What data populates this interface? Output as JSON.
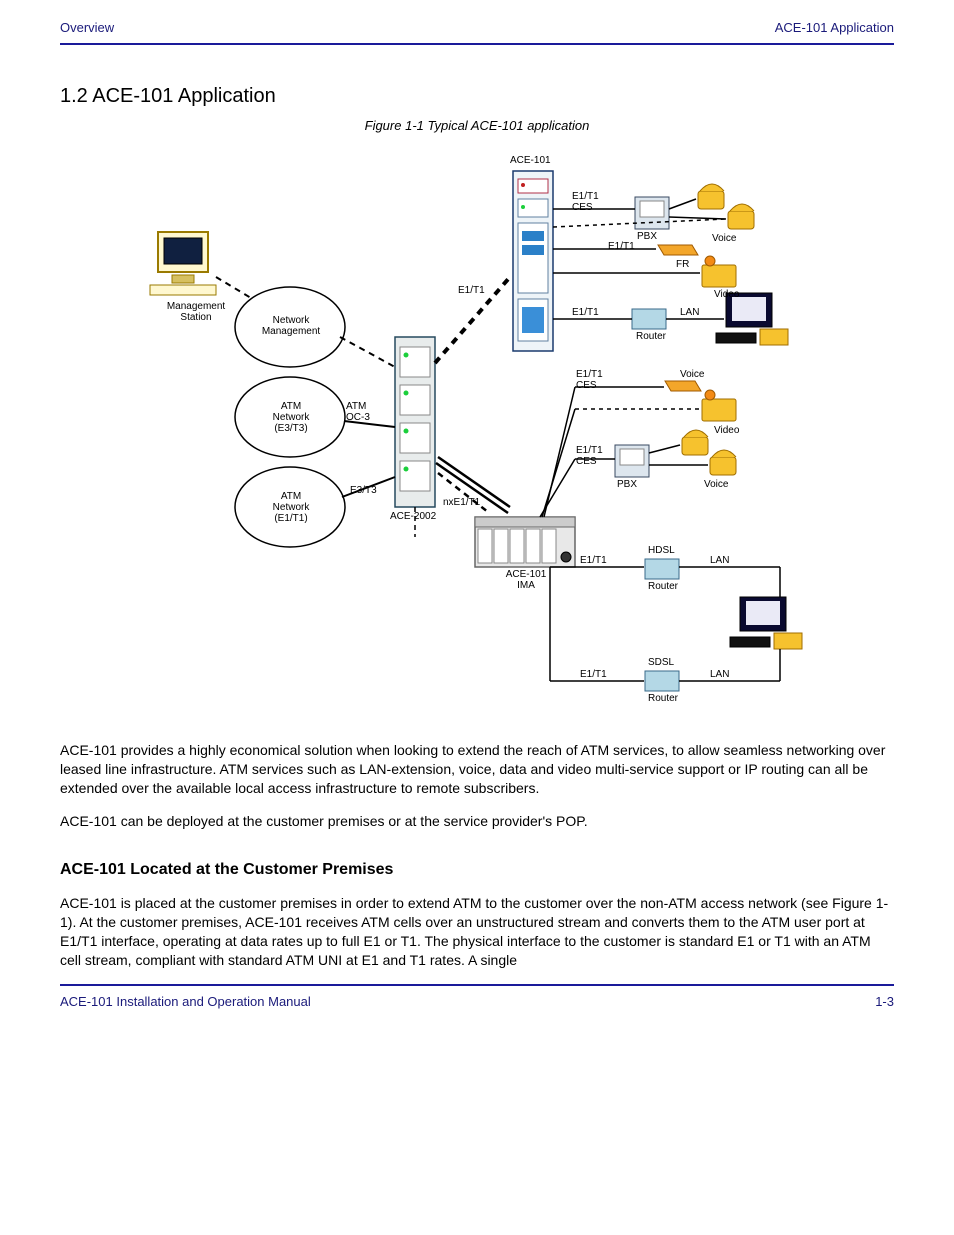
{
  "header": {
    "left": "Overview",
    "right": "ACE-101 Application"
  },
  "section_title": "1.2 ACE-101 Application",
  "figure_caption": "Figure 1-1  Typical ACE-101 application",
  "diagram": {
    "mgmt_station": "Management\nStation",
    "network": "Network\nManagement",
    "cloud_atm_e3": "ATM\nNetwork\n(E3/T3)",
    "cloud_atm_e1": "ATM\nNetwork\n(E1/T1)",
    "ace2002": "ACE-2002",
    "ace101_1": "ACE-101",
    "ace101_2": "ACE-101\nIMA",
    "e1t1": "E1/T1",
    "e1t1_ces": "E1/T1\nCES",
    "atmoc3": "ATM\nOC-3",
    "e3t3": "E3/T3",
    "nxE1T1": "nxE1/T1",
    "pbx": "PBX",
    "lan": "LAN",
    "voice": "Voice",
    "fr": "FR",
    "hdsl": "HDSL",
    "sdsl": "SDSL",
    "pbx2": "PBX",
    "router": "Router",
    "router2": "Router",
    "video": "Video"
  },
  "para1": "ACE-101 provides a highly economical solution when looking to extend the reach of ATM services, to allow seamless networking over leased line infrastructure. ATM services such as LAN-extension, voice, data and video multi-service support or IP routing can all be extended over the available local access infrastructure to remote subscribers.",
  "para2": "ACE-101 can be deployed at the customer premises or at the service provider's POP.",
  "h_cpe": "ACE-101 Located at the Customer Premises",
  "para3": "ACE-101 is placed at the customer premises in order to extend ATM to the customer over the non-ATM access network (see Figure 1-1). At the customer premises, ACE-101 receives ATM cells over an unstructured stream and converts them to the ATM user port at E1/T1 interface, operating at data rates up to full E1 or T1. The physical interface to the customer is standard E1 or T1 with an ATM cell stream, compliant with standard ATM UNI at E1 and T1 rates. A single",
  "footer": {
    "left": "ACE-101 Installation and Operation Manual",
    "right": "1-3"
  },
  "chart_data": {
    "type": "diagram",
    "nodes": [
      {
        "id": "mgmt",
        "label": "Management Station"
      },
      {
        "id": "cloud_nm",
        "label": "Network Management"
      },
      {
        "id": "cloud_e3",
        "label": "ATM Network (E3/T3)"
      },
      {
        "id": "cloud_e1",
        "label": "ATM Network (E1/T1)"
      },
      {
        "id": "ace2002",
        "label": "ACE-2002"
      },
      {
        "id": "ace101_1",
        "label": "ACE-101"
      },
      {
        "id": "ace101_2",
        "label": "ACE-101 IMA"
      },
      {
        "id": "pbx1",
        "label": "PBX"
      },
      {
        "id": "voice1",
        "label": "Voice"
      },
      {
        "id": "fr",
        "label": "FR"
      },
      {
        "id": "video1",
        "label": "Video"
      },
      {
        "id": "router1",
        "label": "Router"
      },
      {
        "id": "lan1",
        "label": "LAN"
      },
      {
        "id": "computer1",
        "label": "Computer"
      },
      {
        "id": "voice2",
        "label": "Voice"
      },
      {
        "id": "video2",
        "label": "Video"
      },
      {
        "id": "pbx2",
        "label": "PBX"
      },
      {
        "id": "hdsl",
        "label": "HDSL Router"
      },
      {
        "id": "sdsl",
        "label": "SDSL Router"
      },
      {
        "id": "computer2",
        "label": "Computer"
      }
    ],
    "edges": [
      {
        "from": "mgmt",
        "to": "cloud_nm",
        "style": "dashed"
      },
      {
        "from": "cloud_nm",
        "to": "ace2002",
        "style": "dashed"
      },
      {
        "from": "cloud_e3",
        "to": "ace2002",
        "label": "ATM OC-3"
      },
      {
        "from": "cloud_e1",
        "to": "ace2002",
        "label": "E3/T3"
      },
      {
        "from": "ace2002",
        "to": "ace101_1",
        "label": "E1/T1",
        "style": "dashed"
      },
      {
        "from": "ace2002",
        "to": "ace101_2",
        "label": "nxE1/T1"
      },
      {
        "from": "ace101_1",
        "to": "pbx1",
        "label": "E1/T1 CES"
      },
      {
        "from": "pbx1",
        "to": "voice1"
      },
      {
        "from": "ace101_1",
        "to": "voice1",
        "style": "dashed"
      },
      {
        "from": "ace101_1",
        "to": "fr"
      },
      {
        "from": "ace101_1",
        "to": "video1"
      },
      {
        "from": "ace101_1",
        "to": "router1",
        "label": "LAN"
      },
      {
        "from": "router1",
        "to": "computer1"
      },
      {
        "from": "ace101_2",
        "to": "voice2",
        "label": "E1/T1 CES"
      },
      {
        "from": "ace101_2",
        "to": "video2",
        "style": "dashed"
      },
      {
        "from": "ace101_2",
        "to": "pbx2",
        "label": "E1/T1 CES"
      },
      {
        "from": "pbx2",
        "to": "voice2"
      },
      {
        "from": "ace101_2",
        "to": "hdsl",
        "label": "E1/T1"
      },
      {
        "from": "ace101_2",
        "to": "sdsl",
        "label": "E1/T1"
      },
      {
        "from": "hdsl",
        "to": "computer2",
        "label": "Router"
      },
      {
        "from": "sdsl",
        "to": "computer2",
        "label": "Router"
      }
    ]
  }
}
